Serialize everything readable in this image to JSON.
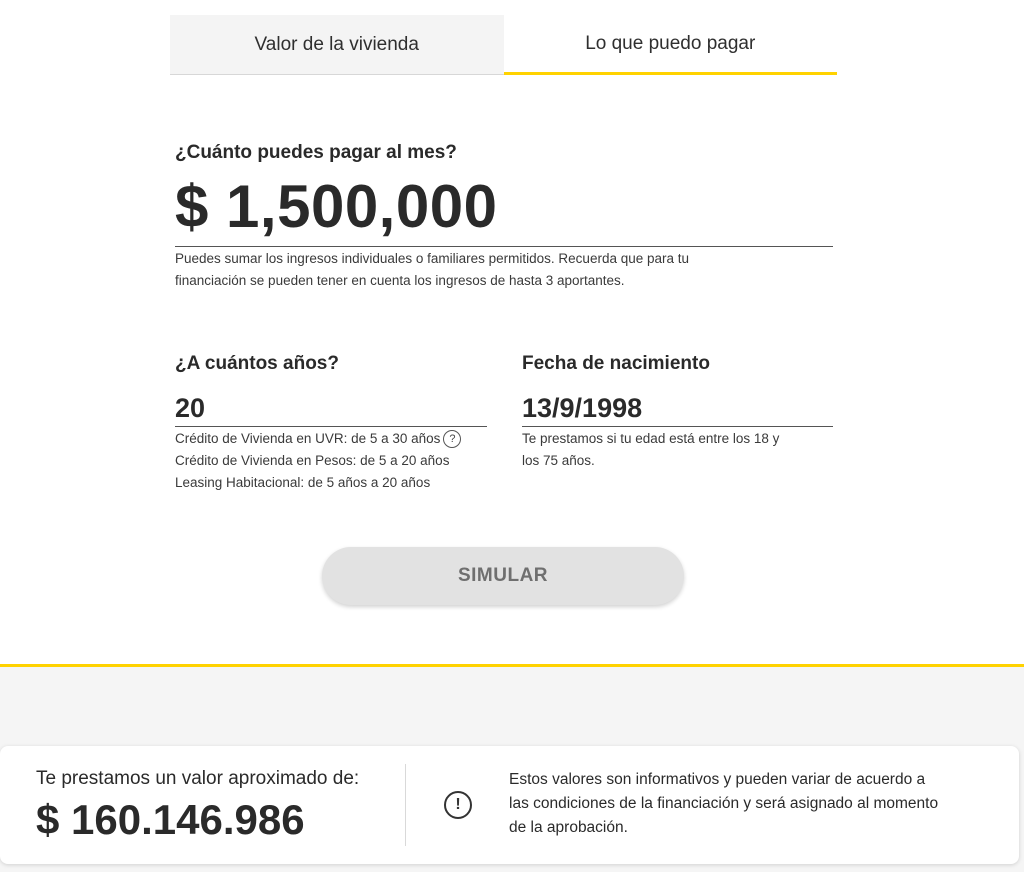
{
  "tabs": {
    "valor": "Valor de la vivienda",
    "pagar": "Lo que puedo pagar"
  },
  "monthly": {
    "label": "¿Cuánto puedes pagar al mes?",
    "amount": "$ 1,500,000",
    "help_line1": "Puedes sumar los ingresos individuales o familiares permitidos. Recuerda que para tu",
    "help_line2": "financiación se pueden tener en cuenta los ingresos de hasta 3 aportantes."
  },
  "years": {
    "label": "¿A cuántos años?",
    "value": "20",
    "help_line1": "Crédito de Vivienda en UVR: de 5 a 30 años",
    "help_icon": "?",
    "help_line2": "Crédito de Vivienda en Pesos: de 5 a 20 años",
    "help_line3": "Leasing Habitacional: de 5 años a 20 años"
  },
  "birth": {
    "label": "Fecha de nacimiento",
    "value": "13/9/1998",
    "help_line1": "Te prestamos si tu edad está entre los 18 y",
    "help_line2": "los 75 años."
  },
  "simulate_button": "SIMULAR",
  "result": {
    "label": "Te prestamos un valor aproximado de:",
    "amount": "$ 160.146.986",
    "warn_icon": "!",
    "disclaimer_line1": "Estos valores son informativos y pueden variar de acuerdo a",
    "disclaimer_line2": "las condiciones de la financiación y será asignado al momento",
    "disclaimer_line3": "de la aprobación."
  },
  "colors": {
    "accent": "#ffd200",
    "text": "#2a2a2a",
    "button_bg": "#e2e2e2"
  }
}
